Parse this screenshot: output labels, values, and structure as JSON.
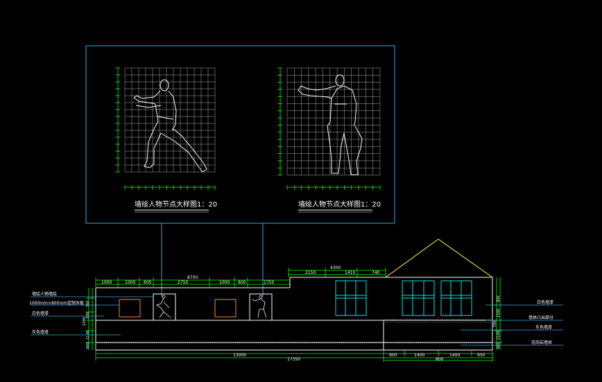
{
  "detail_captions": [
    "墙绘人物节点大样图1：20",
    "墙绘人物节点大样图1：20"
  ],
  "callouts_left": {
    "mural_figure": "墙绘人物墙绘",
    "wood_board": "1000mm×800mm定制木板",
    "white_wall": "白色墙漆",
    "gray_wall": "灰色墙漆"
  },
  "callouts_right": {
    "white_wall": "白色墙漆",
    "wall_protrusion": "墙体凸出部分",
    "gray_wall": "灰色墙漆",
    "planter_wall": "花岗岩墙体"
  },
  "top_dims": {
    "segments": [
      "1000",
      "1000",
      "600",
      "2750",
      "1000",
      "600",
      "1750"
    ],
    "total_left": "8700",
    "right_segments": [
      "2150",
      "1410",
      "740"
    ],
    "total_right": "4300"
  },
  "bottom_dims": {
    "left": "13000",
    "total": "17350",
    "segments": [
      "900",
      "1400",
      "1400",
      "950"
    ],
    "sub_total": "800"
  },
  "left_vertical_dims": [
    "700",
    "300",
    "1200",
    "1100",
    "600"
  ],
  "right_vertical_dims": [
    "800",
    "1500",
    "700",
    "1100",
    "600"
  ],
  "colors": {
    "background": "#000000",
    "frame": "#3fa9d9",
    "grid": "#ffffff",
    "dimension": "#00ff00",
    "roof": "#ffff33",
    "window": "#00e5e5",
    "board": "#ff8c1a"
  }
}
